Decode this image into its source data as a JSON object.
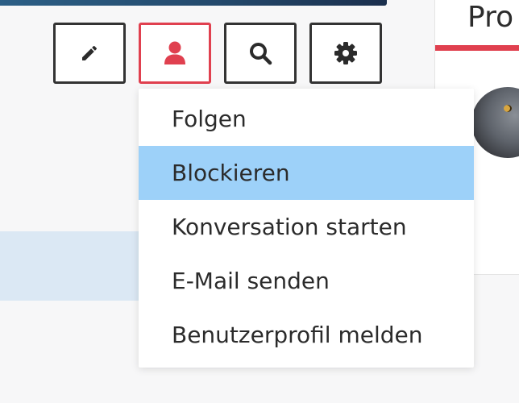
{
  "profile_panel": {
    "title": "Pro"
  },
  "toolbar": {
    "buttons": [
      {
        "name": "edit",
        "icon": "pencil-icon"
      },
      {
        "name": "user",
        "icon": "user-icon",
        "active": true,
        "color": "#e0404f"
      },
      {
        "name": "search",
        "icon": "search-icon"
      },
      {
        "name": "settings",
        "icon": "gear-icon"
      }
    ]
  },
  "dropdown": {
    "items": [
      {
        "label": "Folgen"
      },
      {
        "label": "Blockieren",
        "highlighted": true
      },
      {
        "label": "Konversation starten"
      },
      {
        "label": "E-Mail senden"
      },
      {
        "label": "Benutzerprofil melden"
      }
    ]
  },
  "colors": {
    "accent": "#e0404f",
    "highlight": "#9dd1f9",
    "border": "#333333"
  }
}
